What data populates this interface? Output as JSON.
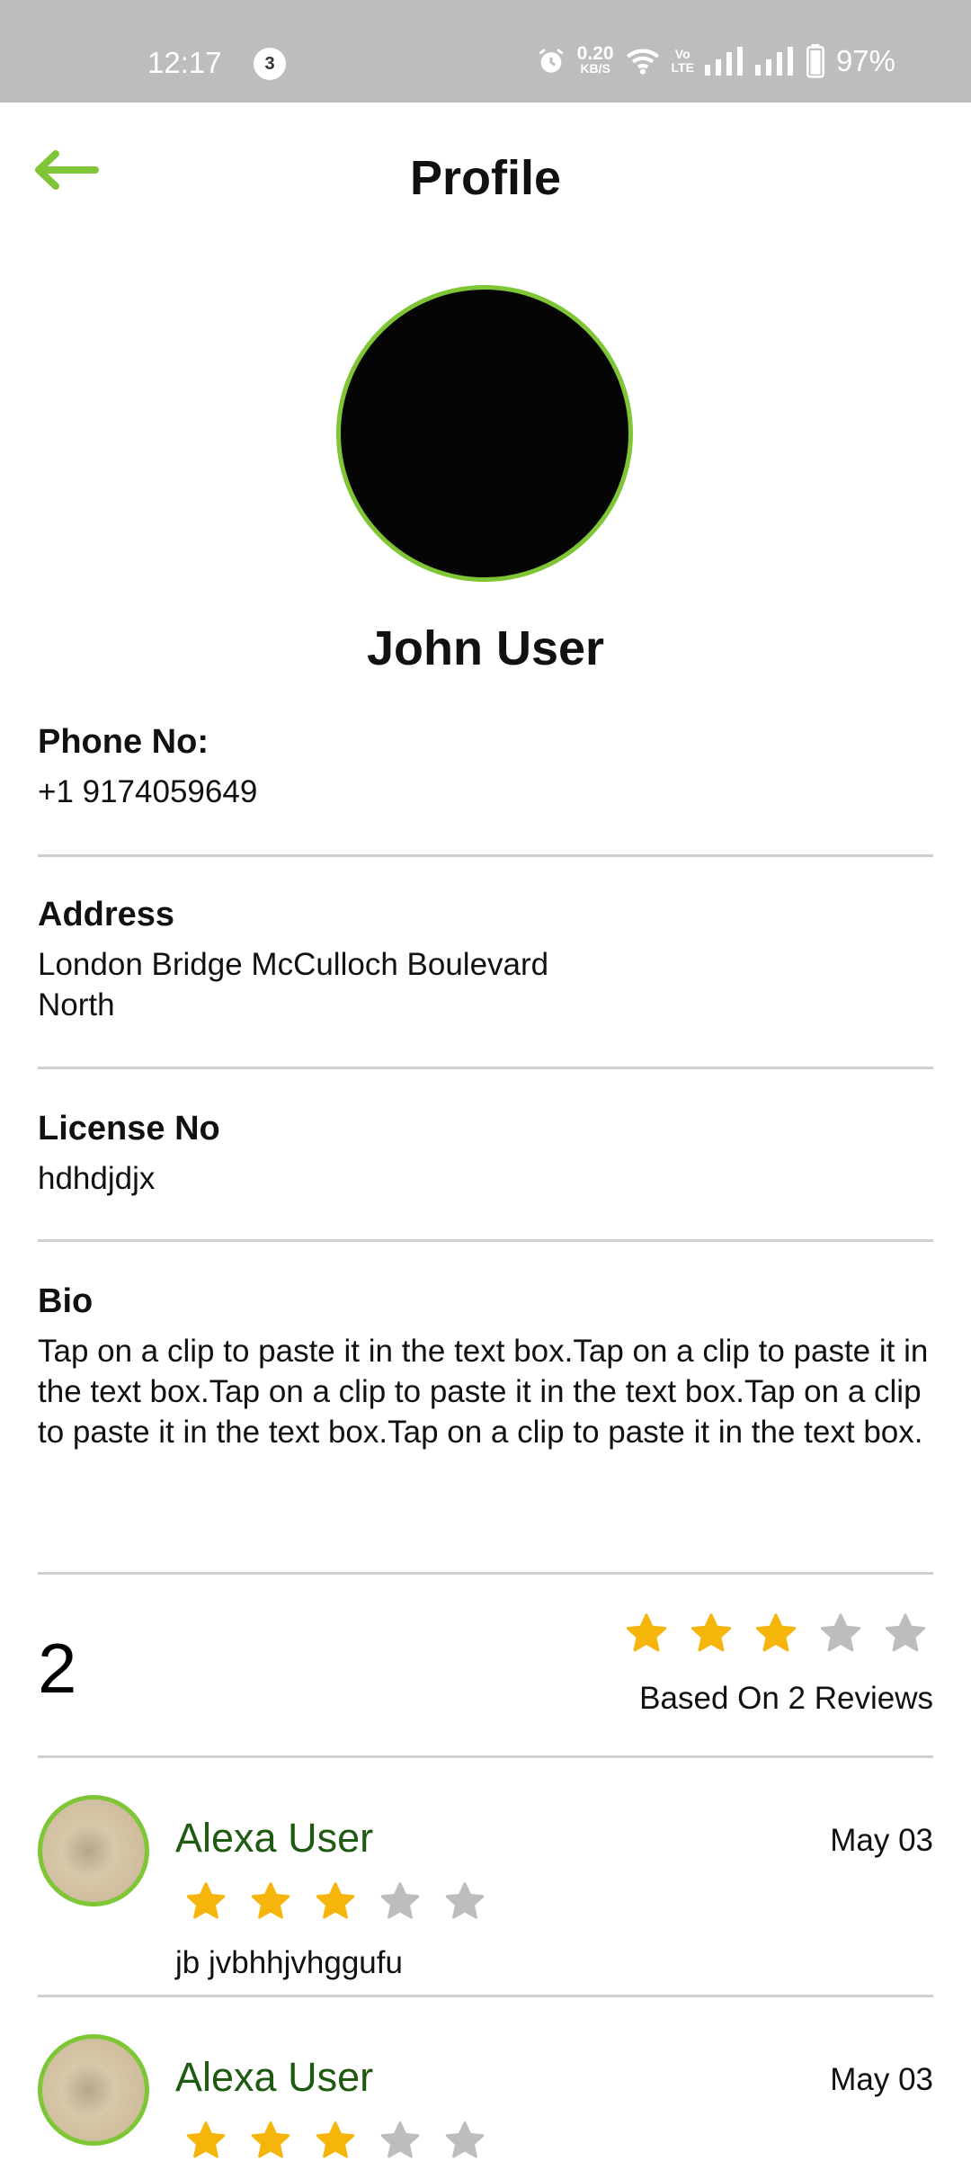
{
  "status_bar": {
    "time": "12:17",
    "notification_count": "3",
    "net_speed_value": "0.20",
    "net_speed_unit": "KB/S",
    "volte_top": "Vo",
    "volte_bottom": "LTE",
    "battery": "97%"
  },
  "header": {
    "title": "Profile",
    "back_icon": "arrow-left-icon",
    "accent_color": "#7ec636"
  },
  "profile": {
    "name": "John User"
  },
  "fields": {
    "phone_label": "Phone No:",
    "phone_value": "+1 9174059649",
    "address_label": "Address",
    "address_line1": "London Bridge McCulloch Boulevard",
    "address_line2": "North",
    "license_label": "License No",
    "license_value": "hdhdjdjx",
    "bio_label": "Bio",
    "bio_value": "Tap on a clip to paste it in the text box.Tap on a clip to paste it in the text box.Tap on a clip to paste it in the text box.Tap on a clip to paste it in the text box.Tap on a clip to paste it in the text box."
  },
  "rating": {
    "count": "2",
    "stars_filled": 3,
    "stars_total": 5,
    "based_on": "Based  On 2 Reviews",
    "filled_color": "#f5b50a",
    "empty_color": "#bdbdbd"
  },
  "reviews": [
    {
      "name": "Alexa User",
      "date": "May 03",
      "stars_filled": 3,
      "text": "jb jvbhhjvhggufu"
    },
    {
      "name": "Alexa User",
      "date": "May 03",
      "stars_filled": 3,
      "text": ""
    }
  ]
}
